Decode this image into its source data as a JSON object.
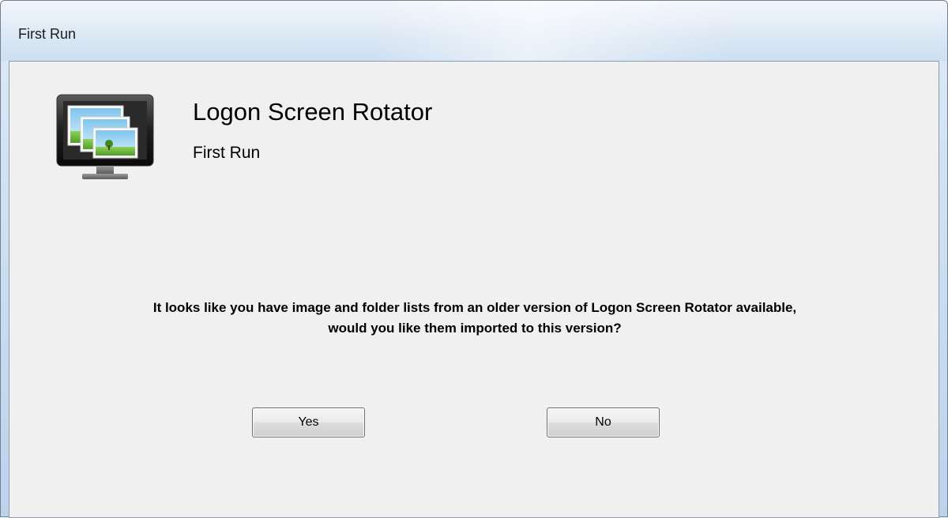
{
  "window": {
    "title": "First Run"
  },
  "header": {
    "app_name": "Logon Screen Rotator",
    "subtitle": "First Run",
    "icon": "monitor-with-pictures-icon"
  },
  "message": {
    "line1": "It looks like you have image and folder lists from an older version of Logon Screen Rotator available,",
    "line2": "would you like them imported to this version?"
  },
  "buttons": {
    "yes_label": "Yes",
    "no_label": "No"
  },
  "colors": {
    "titlebar": "#dbe7f4",
    "client_bg": "#f0f0f0",
    "button_border": "#707070"
  }
}
